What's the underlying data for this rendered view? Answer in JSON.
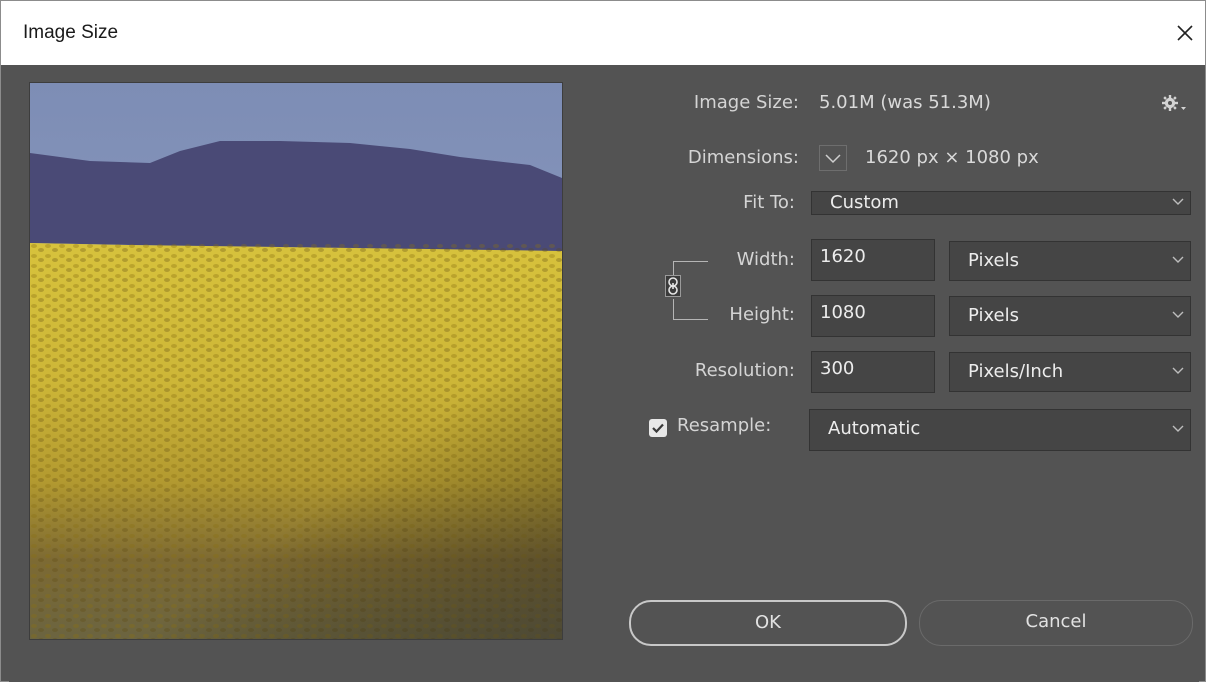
{
  "dialog": {
    "title": "Image Size"
  },
  "info": {
    "image_size_label": "Image Size:",
    "image_size_value": "5.01M (was 51.3M)",
    "dimensions_label": "Dimensions:",
    "dimensions_value": "1620 px  ×  1080 px"
  },
  "fit_to": {
    "label": "Fit To:",
    "value": "Custom"
  },
  "width": {
    "label": "Width:",
    "value": "1620",
    "unit": "Pixels"
  },
  "height": {
    "label": "Height:",
    "value": "1080",
    "unit": "Pixels"
  },
  "resolution": {
    "label": "Resolution:",
    "value": "300",
    "unit": "Pixels/Inch"
  },
  "resample": {
    "label": "Resample:",
    "checked": true,
    "value": "Automatic"
  },
  "buttons": {
    "ok": "OK",
    "cancel": "Cancel"
  },
  "colors": {
    "dialog_bg": "#535353",
    "field_bg": "#454545",
    "titlebar_bg": "#ffffff",
    "text": "#d4d4d4"
  },
  "icons": {
    "close": "close-icon",
    "gear": "gear-icon",
    "link": "chain-link-icon",
    "chevron": "chevron-down-icon",
    "check": "checkmark-icon"
  }
}
